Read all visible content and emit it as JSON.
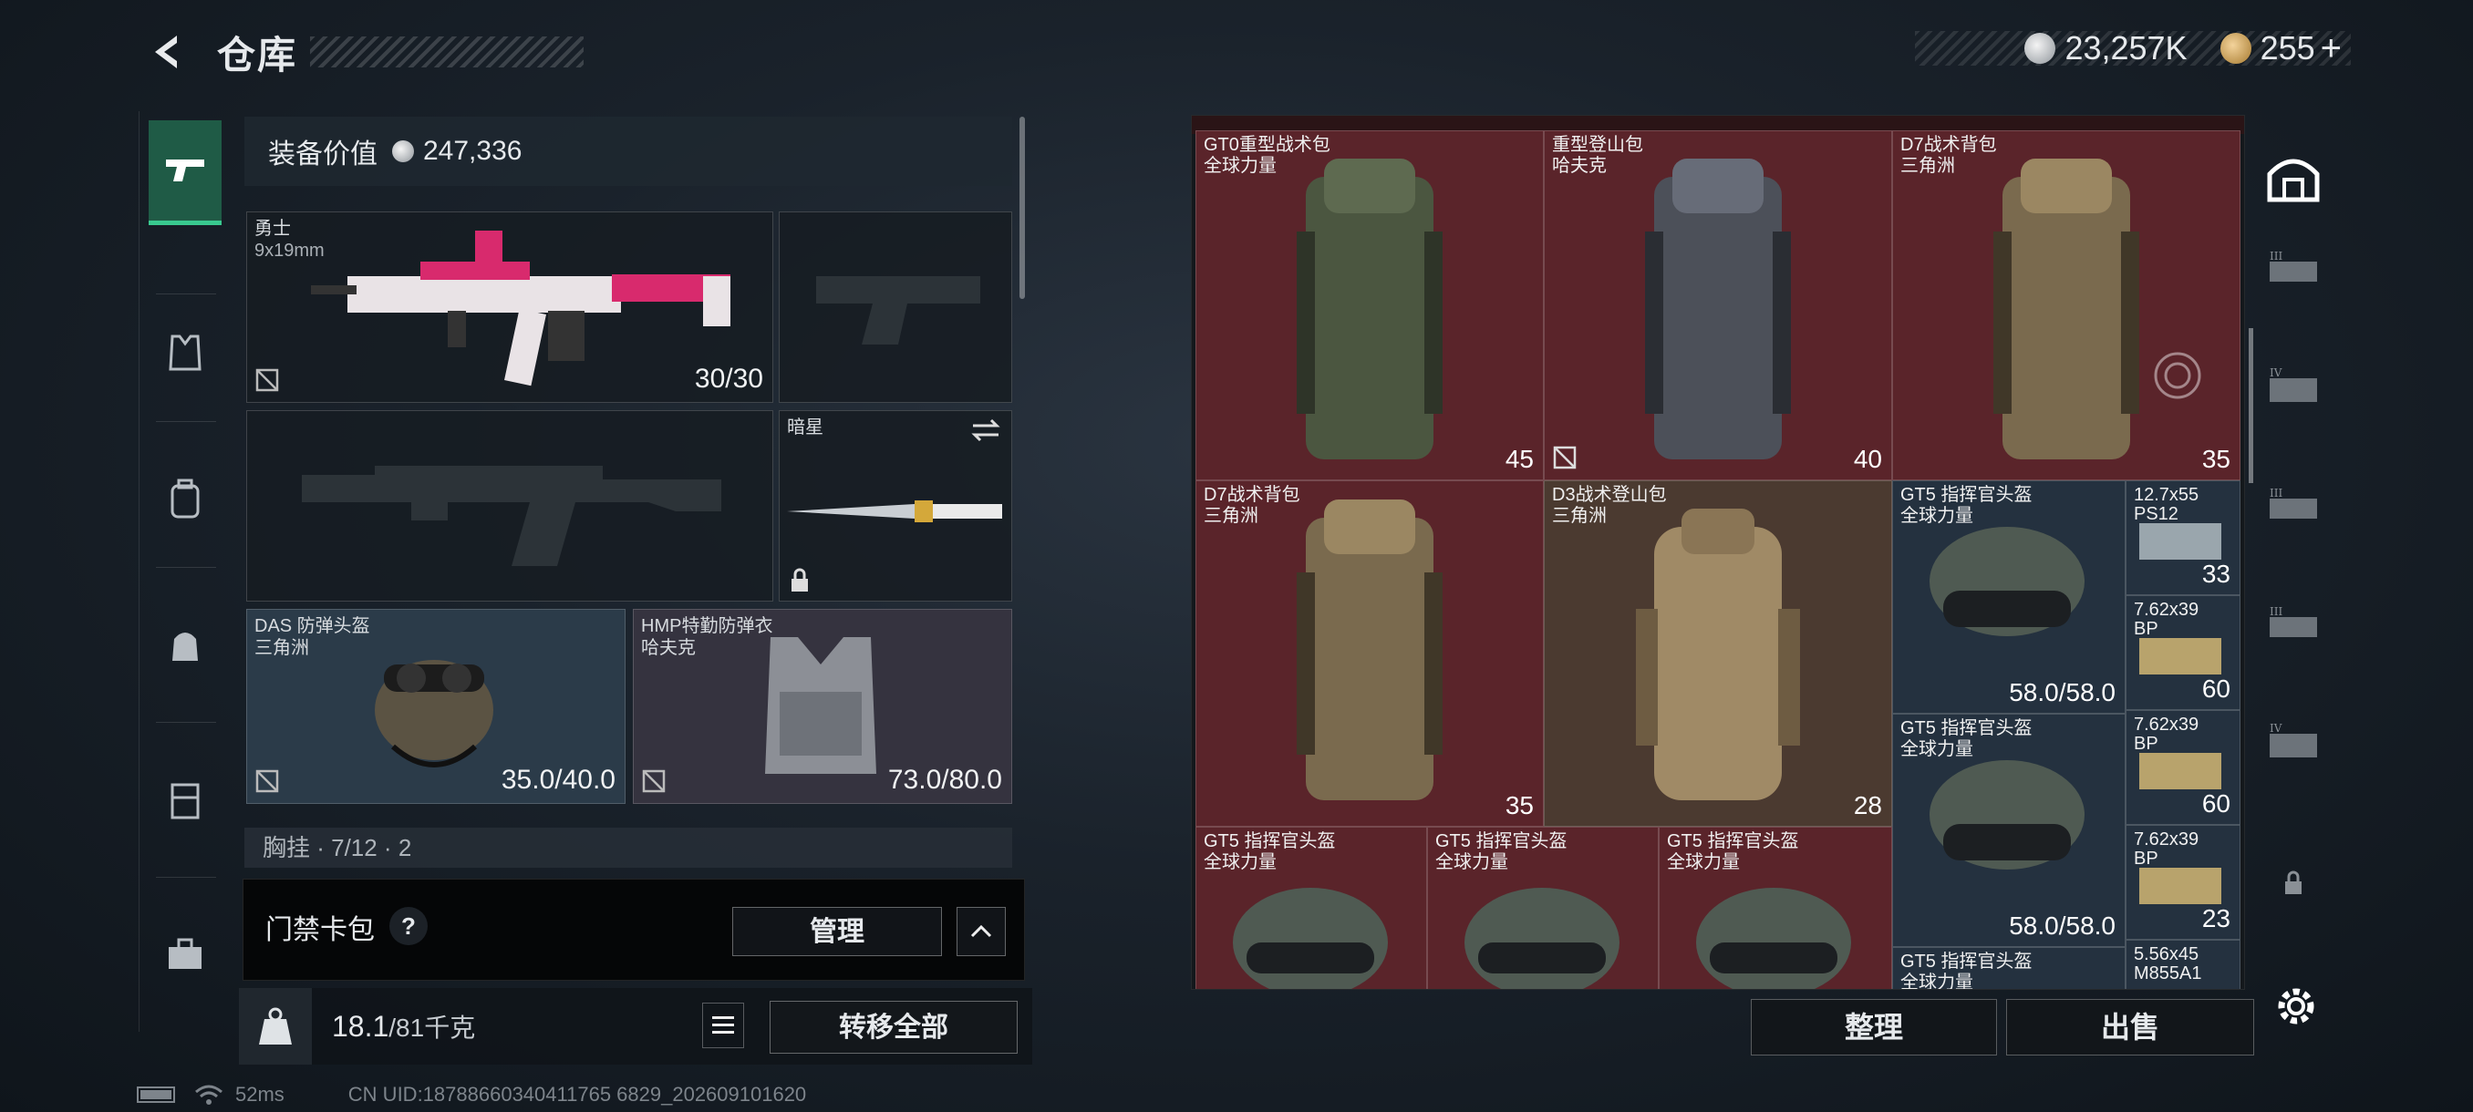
{
  "header": {
    "title": "仓库",
    "back_icon": "back-arrow-icon"
  },
  "currency": {
    "silver": "23,257K",
    "gold": "255",
    "plus": "+"
  },
  "loadout": {
    "value_label": "装备价值",
    "value": "247,336",
    "primary": {
      "name": "勇士",
      "caliber": "9x19mm",
      "ammo": "30/30"
    },
    "melee": {
      "name": "暗星"
    },
    "helmet": {
      "name": "DAS 防弹头盔",
      "maker": "三角洲",
      "durability": "35.0/40.0"
    },
    "armor": {
      "name": "HMP特勤防弹衣",
      "maker": "哈夫克",
      "durability": "73.0/80.0"
    },
    "chest_partial": "胸挂 · 7/12 · 2"
  },
  "card_pack": {
    "label": "门禁卡包",
    "help": "?",
    "manage": "管理"
  },
  "weight": {
    "current": "18.1",
    "max": "/81千克",
    "move_all": "转移全部"
  },
  "status": {
    "ping": "52ms",
    "uid": "CN UID:18788660340411765 6829_202609101620"
  },
  "storage": {
    "items": [
      {
        "name": "GT0重型战术包",
        "maker": "全球力量",
        "count": "45"
      },
      {
        "name": "重型登山包",
        "maker": "哈夫克",
        "count": "40"
      },
      {
        "name": "D7战术背包",
        "maker": "三角洲",
        "count": "35"
      },
      {
        "name": "D7战术背包",
        "maker": "三角洲",
        "count": "35"
      },
      {
        "name": "D3战术登山包",
        "maker": "三角洲",
        "count": "28"
      },
      {
        "name": "GT5 指挥官头盔",
        "maker": "全球力量",
        "count": "58.0/58.0"
      },
      {
        "name": "GT5 指挥官头盔",
        "maker": "全球力量",
        "count": "58.0/58.0"
      },
      {
        "name": "GT5 指挥官头盔",
        "maker": "全球力量",
        "count": ""
      },
      {
        "name": "GT5 指挥官头盔",
        "maker": "全球力量",
        "count": ""
      },
      {
        "name": "GT5 指挥官头盔",
        "maker": "全球力量",
        "count": ""
      },
      {
        "name": "GT5 指挥官头盔",
        "maker": "全球力量",
        "count": ""
      }
    ],
    "ammo": [
      {
        "name": "12.7x55",
        "sub": "PS12",
        "count": "33"
      },
      {
        "name": "7.62x39",
        "sub": "BP",
        "count": "60"
      },
      {
        "name": "7.62x39",
        "sub": "BP",
        "count": "60"
      },
      {
        "name": "7.62x39",
        "sub": "BP",
        "count": "23"
      },
      {
        "name": "5.56x45",
        "sub": "M855A1",
        "count": ""
      }
    ],
    "sort": "整理",
    "sell": "出售"
  }
}
